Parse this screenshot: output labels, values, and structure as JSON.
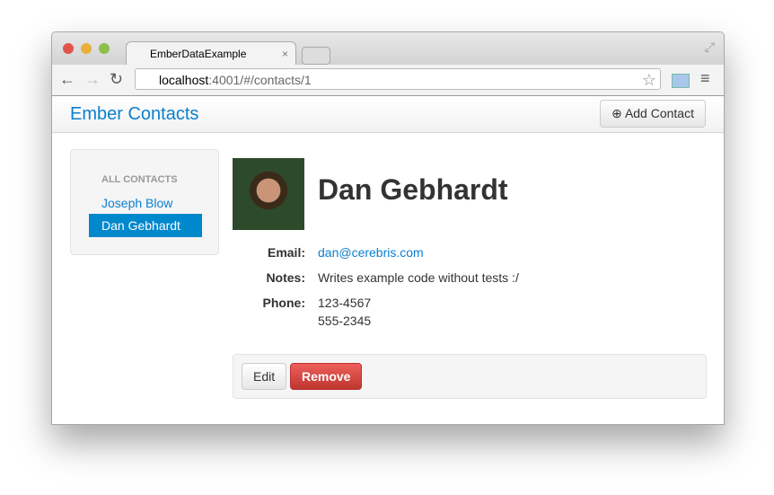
{
  "browser": {
    "tab_title": "EmberDataExample",
    "url_host": "localhost",
    "url_path": ":4001/#/contacts/1"
  },
  "navbar": {
    "brand": "Ember Contacts",
    "add_contact": "Add Contact"
  },
  "sidebar": {
    "header": "ALL CONTACTS",
    "items": [
      {
        "label": "Joseph Blow",
        "active": false
      },
      {
        "label": "Dan Gebhardt",
        "active": true
      }
    ]
  },
  "contact": {
    "name": "Dan Gebhardt",
    "email_label": "Email:",
    "email": "dan@cerebris.com",
    "notes_label": "Notes:",
    "notes": "Writes example code without tests :/",
    "phone_label": "Phone:",
    "phones": [
      "123-4567",
      "555-2345"
    ]
  },
  "actions": {
    "edit": "Edit",
    "remove": "Remove"
  },
  "colors": {
    "accent": "#0088cc",
    "danger": "#da4f49"
  }
}
